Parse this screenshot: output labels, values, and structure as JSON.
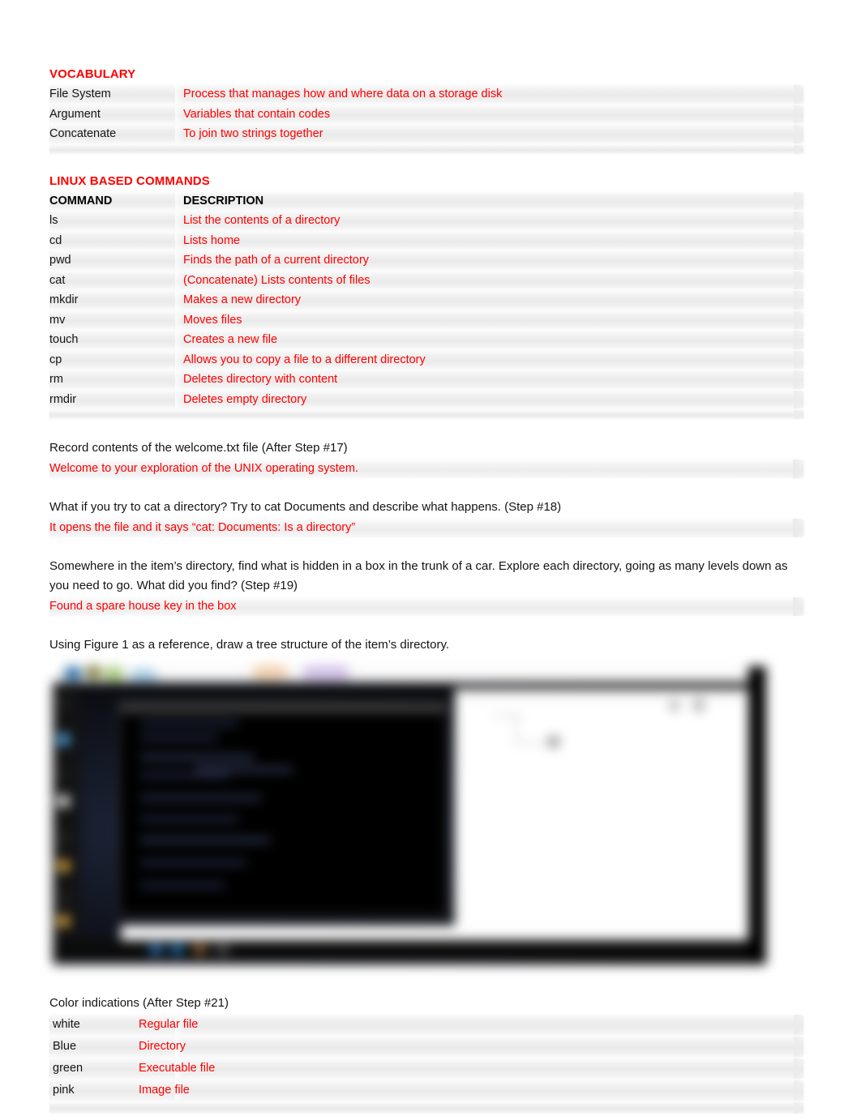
{
  "document": {
    "vocabulary": {
      "title": "VOCABULARY",
      "rows": [
        {
          "term": "File System",
          "definition": "Process that manages how and where data on a storage disk"
        },
        {
          "term": "Argument",
          "definition": "Variables that contain codes"
        },
        {
          "term": "Concatenate",
          "definition": "To join two strings together"
        }
      ]
    },
    "commands": {
      "title": "LINUX BASED COMMANDS",
      "header": {
        "command": "COMMAND",
        "description": "DESCRIPTION"
      },
      "rows": [
        {
          "command": "ls",
          "description": "List the contents of a directory"
        },
        {
          "command": "cd",
          "description": "Lists home"
        },
        {
          "command": "pwd",
          "description": "Finds the path of a current directory"
        },
        {
          "command": "cat",
          "description": "(Concatenate) Lists contents of files"
        },
        {
          "command": "mkdir",
          "description": "Makes a new directory"
        },
        {
          "command": "mv",
          "description": "Moves files"
        },
        {
          "command": "touch",
          "description": "Creates a new file"
        },
        {
          "command": "cp",
          "description": "Allows you to copy a file to a different directory"
        },
        {
          "command": "rm",
          "description": "Deletes directory with content"
        },
        {
          "command": "rmdir",
          "description": "Deletes empty directory"
        }
      ]
    },
    "questions": [
      {
        "prompt": "Record contents of the welcome.txt file (After Step #17)",
        "answer": "Welcome to your exploration of the UNIX operating system."
      },
      {
        "prompt": "What if you try to cat a directory? Try to cat Documents and describe what happens. (Step #18)",
        "answer": "It opens the file and it says “cat: Documents: Is a directory”"
      },
      {
        "prompt": "Somewhere in the item’s directory, find what is hidden in a box in the trunk of a car. Explore each directory, going as many levels down as you need to go. What did you find? (Step #19)",
        "answer": "Found a spare house key in the box"
      }
    ],
    "figure_prompt": "Using Figure 1 as a reference, draw a tree structure of the item’s directory.",
    "figure": {
      "alt": "blurred desktop screenshot with terminal window and document"
    },
    "colors": {
      "title": "Color indications (After Step #21)",
      "rows": [
        {
          "color": "white",
          "meaning": "Regular file"
        },
        {
          "color": "Blue",
          "meaning": "Directory"
        },
        {
          "color": "green",
          "meaning": "Executable file"
        },
        {
          "color": "pink",
          "meaning": "Image file"
        }
      ]
    },
    "accents": {
      "answer_red": "#FF0000",
      "heading_red": "#FF0000",
      "body_black": "#141414",
      "row_shade": "#ececec"
    }
  }
}
